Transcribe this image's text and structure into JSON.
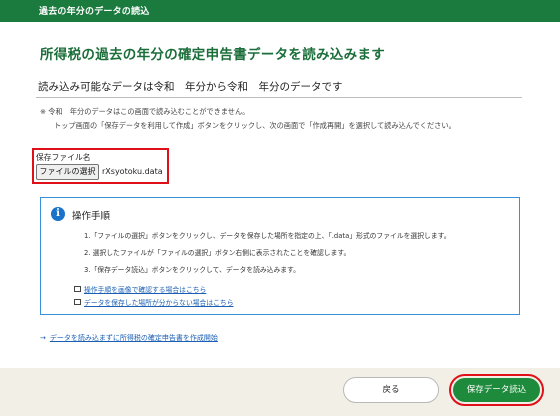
{
  "header": {
    "title": "過去の年分のデータの読込"
  },
  "main": {
    "title": "所得税の過去の年分の確定申告書データを読み込みます",
    "sub_heading": "読み込み可能なデータは令和　年分から令和　年分のデータです",
    "notice_line1": "※ 令和　年分のデータはこの画面で読み込むことができません。",
    "notice_line2": "トップ画面の「保存データを利用して作成」ボタンをクリックし、次の画面で「作成再開」を選択して読み込んでください。"
  },
  "file_input": {
    "label": "保存ファイル名",
    "button_label": "ファイルの選択",
    "file_name": "rXsyotoku.data"
  },
  "steps": {
    "title": "操作手順",
    "items": [
      "1.「ファイルの選択」ボタンをクリックし、データを保存した場所を指定の上、「.data」形式のファイルを選択します。",
      "2. 選択したファイルが「ファイルの選択」ボタン右側に表示されたことを確認します。",
      "3.「保存データ読込」ボタンをクリックして、データを読み込みます。"
    ],
    "links": [
      "操作手順を画像で確認する場合はこちら",
      "データを保存した場所が分からない場合はこちら"
    ]
  },
  "skip_link": "データを読み込まずに所得税の確定申告書を作成開始",
  "footer": {
    "back_label": "戻る",
    "submit_label": "保存データ読込"
  },
  "colors": {
    "header_green": "#1b7b3f",
    "title_green": "#1b6e3a",
    "highlight_red": "#e0101a",
    "info_blue": "#1a73c9",
    "link_blue": "#1a5fb4",
    "footer_bg": "#f2efe6",
    "submit_green": "#1e8a3c"
  },
  "icons": {
    "info": "info-icon",
    "external_link": "external-link-icon",
    "arrow": "arrow-right-icon"
  }
}
